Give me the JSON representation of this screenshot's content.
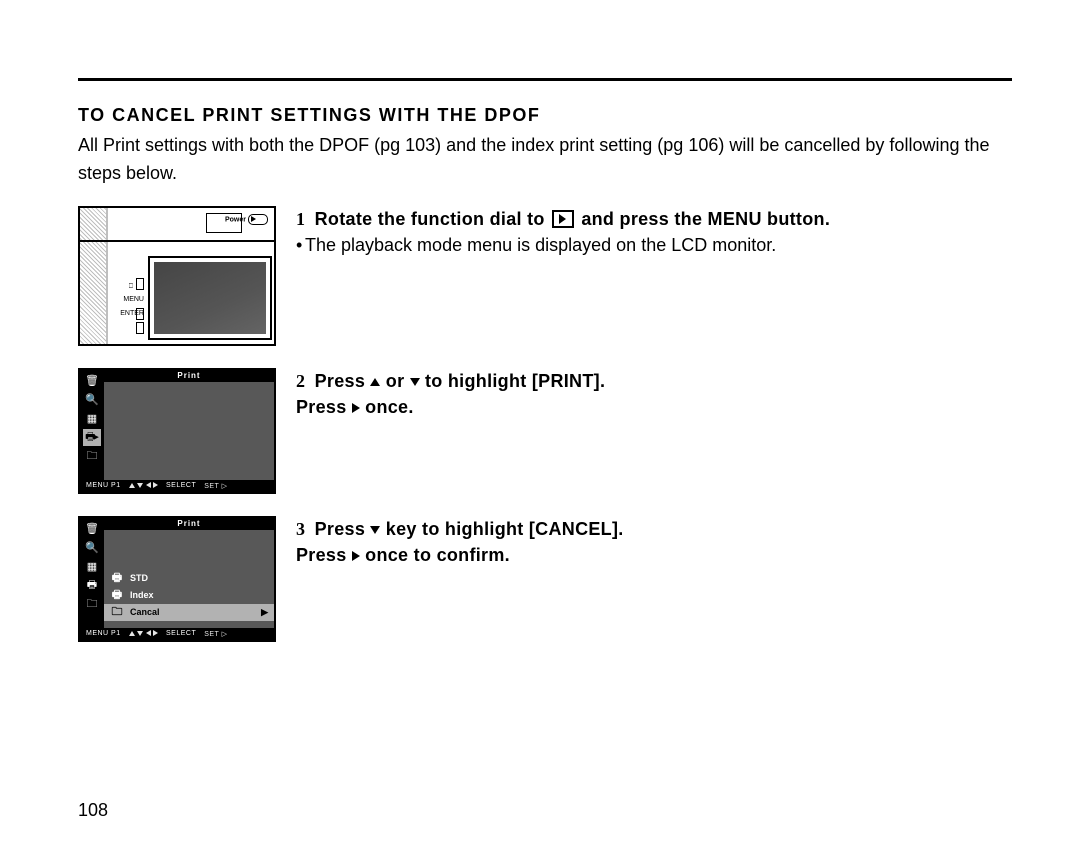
{
  "page_number": "108",
  "section_title": "To Cancel Print Settings with the DPOF",
  "intro_text": "All Print settings with both the DPOF (pg 103) and the index print setting (pg 106) will be cancelled by following the steps below.",
  "steps": [
    {
      "num": "1",
      "heading_pre": "Rotate the function dial to ",
      "heading_post": " and press the MENU button.",
      "detail_bullet": "The playback mode menu is displayed on the LCD monitor."
    },
    {
      "num": "2",
      "heading_line1_pre": "Press ",
      "heading_line1_mid": " or ",
      "heading_line1_post": " to highlight [PRINT].",
      "heading_line2_pre": "Press  ",
      "heading_line2_post": " once."
    },
    {
      "num": "3",
      "heading_line1_pre": "Press  ",
      "heading_line1_post": "  key to highlight [CANCEL].",
      "heading_line2_pre": "Press  ",
      "heading_line2_post": "  once to confirm."
    }
  ],
  "camera_illus": {
    "power_label": "Power",
    "btn_labels": [
      "",
      "MENU",
      "ENTER"
    ],
    "top_btn_icon": "◻"
  },
  "menu_illus_common": {
    "titlebar": "Print",
    "footer_menu": "MENU P1",
    "footer_select": "SELECT",
    "footer_set": "SET"
  },
  "menu_illus_3_rows": [
    {
      "icon": "print-std-icon",
      "label": "STD"
    },
    {
      "icon": "print-index-icon",
      "label": "Index"
    },
    {
      "icon": "folder-icon",
      "label": "Cancal",
      "highlight": true
    }
  ],
  "sidebar_icons": [
    "trash-icon",
    "magnifier-icon",
    "grid-icon",
    "print-icon",
    "folder-icon"
  ]
}
